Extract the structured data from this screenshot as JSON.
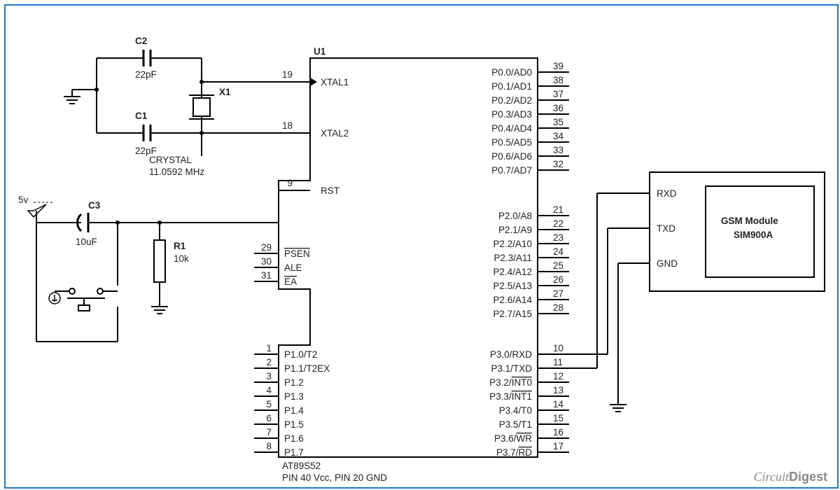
{
  "chip": {
    "ref": "U1",
    "part": "AT89S52",
    "power_note": "PIN 40 Vcc, PIN 20 GND",
    "left_pins": [
      {
        "num": "19",
        "label": "XTAL1"
      },
      {
        "num": "18",
        "label": "XTAL2"
      },
      {
        "num": "9",
        "label": "RST"
      },
      {
        "num": "29",
        "label": "PSEN",
        "bar": true
      },
      {
        "num": "30",
        "label": "ALE"
      },
      {
        "num": "31",
        "label": "EA",
        "bar": true
      },
      {
        "num": "1",
        "label": "P1.0/T2"
      },
      {
        "num": "2",
        "label": "P1.1/T2EX"
      },
      {
        "num": "3",
        "label": "P1.2"
      },
      {
        "num": "4",
        "label": "P1.3"
      },
      {
        "num": "5",
        "label": "P1.4"
      },
      {
        "num": "6",
        "label": "P1.5"
      },
      {
        "num": "7",
        "label": "P1.6"
      },
      {
        "num": "8",
        "label": "P1.7"
      }
    ],
    "right_pins": [
      {
        "num": "39",
        "label": "P0.0/AD0"
      },
      {
        "num": "38",
        "label": "P0.1/AD1"
      },
      {
        "num": "37",
        "label": "P0.2/AD2"
      },
      {
        "num": "36",
        "label": "P0.3/AD3"
      },
      {
        "num": "35",
        "label": "P0.4/AD4"
      },
      {
        "num": "34",
        "label": "P0.5/AD5"
      },
      {
        "num": "33",
        "label": "P0.6/AD6"
      },
      {
        "num": "32",
        "label": "P0.7/AD7"
      },
      {
        "num": "21",
        "label": "P2.0/A8"
      },
      {
        "num": "22",
        "label": "P2.1/A9"
      },
      {
        "num": "23",
        "label": "P2.2/A10"
      },
      {
        "num": "24",
        "label": "P2.3/A11"
      },
      {
        "num": "25",
        "label": "P2.4/A12"
      },
      {
        "num": "26",
        "label": "P2.5/A13"
      },
      {
        "num": "27",
        "label": "P2.6/A14"
      },
      {
        "num": "28",
        "label": "P2.7/A15"
      },
      {
        "num": "10",
        "label": "P3.0/RXD"
      },
      {
        "num": "11",
        "label": "P3.1/TXD"
      },
      {
        "num": "12",
        "label": "P3.2/INT0",
        "bar": "INT0"
      },
      {
        "num": "13",
        "label": "P3.3/INT1",
        "bar": "INT1"
      },
      {
        "num": "14",
        "label": "P3.4/T0"
      },
      {
        "num": "15",
        "label": "P3.5/T1"
      },
      {
        "num": "16",
        "label": "P3.6/WR",
        "bar": "WR"
      },
      {
        "num": "17",
        "label": "P3.7/RD",
        "bar": "RD"
      }
    ]
  },
  "components": {
    "C2": {
      "ref": "C2",
      "value": "22pF"
    },
    "C1": {
      "ref": "C1",
      "value": "22pF"
    },
    "X1": {
      "ref": "X1",
      "label": "CRYSTAL",
      "freq": "11.0592 MHz"
    },
    "C3": {
      "ref": "C3",
      "value": "10uF"
    },
    "R1": {
      "ref": "R1",
      "value": "10k"
    },
    "supply": "5v"
  },
  "gsm": {
    "title1": "GSM Module",
    "title2": "SIM900A",
    "pins": [
      "RXD",
      "TXD",
      "GND"
    ]
  },
  "watermark": "CircuitDigest"
}
